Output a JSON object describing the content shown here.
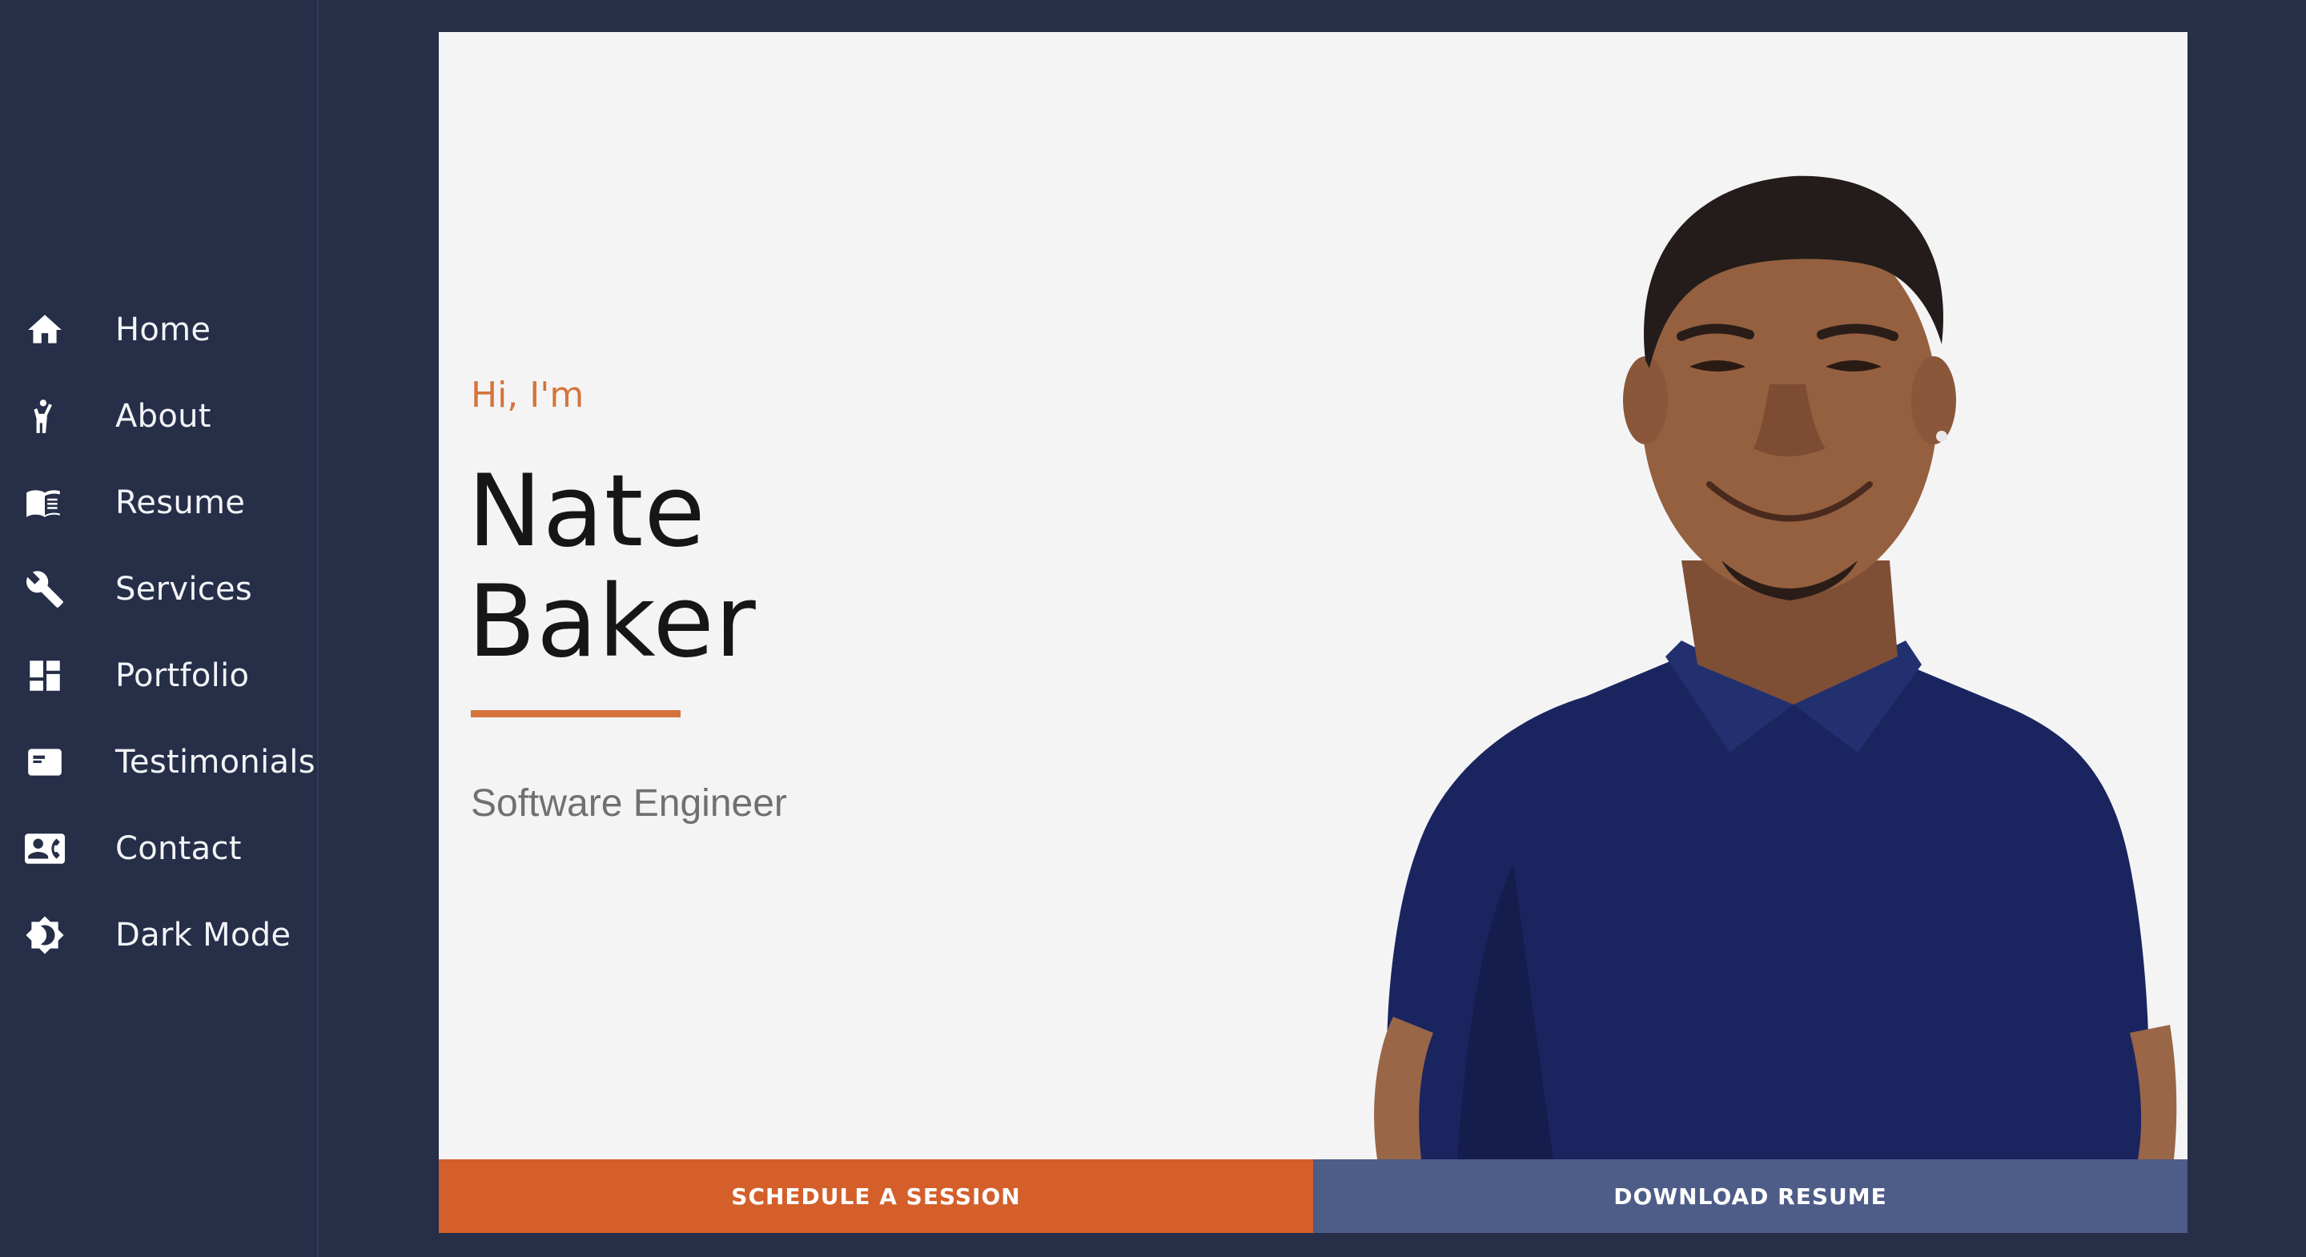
{
  "sidebar": {
    "items": [
      {
        "label": "Home",
        "icon": "home-icon"
      },
      {
        "label": "About",
        "icon": "person-waving-icon"
      },
      {
        "label": "Resume",
        "icon": "book-icon"
      },
      {
        "label": "Services",
        "icon": "wrench-icon"
      },
      {
        "label": "Portfolio",
        "icon": "dashboard-icon"
      },
      {
        "label": "Testimonials",
        "icon": "card-icon"
      },
      {
        "label": "Contact",
        "icon": "contact-card-icon"
      },
      {
        "label": "Dark Mode",
        "icon": "brightness-icon"
      }
    ]
  },
  "hero": {
    "greeting": "Hi, I'm",
    "first_name": "Nate",
    "last_name": "Baker",
    "role": "Software Engineer",
    "photo_icon": "portrait-photo"
  },
  "buttons": {
    "schedule": "SCHEDULE A SESSION",
    "resume": "DOWNLOAD RESUME"
  },
  "colors": {
    "background": "#262e48",
    "accent": "#d6733a",
    "schedule_button": "#d45f2b",
    "resume_button": "#4e5c88",
    "card": "#f4f4f5"
  }
}
